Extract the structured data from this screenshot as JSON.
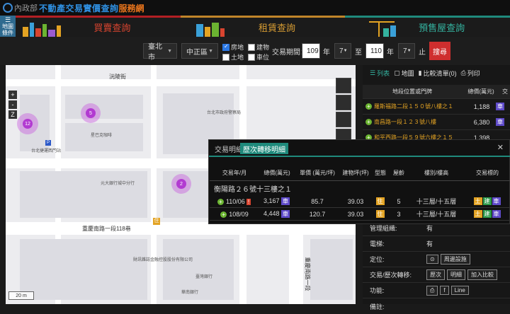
{
  "header": {
    "brand_prefix": "內政部",
    "brand_main": "不動產交易實價查詢",
    "brand_accent": "服務網"
  },
  "side_filter_label": "地圖條件",
  "tabs": [
    {
      "label": "買賣查詢"
    },
    {
      "label": "租賃查詢"
    },
    {
      "label": "預售屋查詢"
    }
  ],
  "filters": {
    "city": "臺北市",
    "district": "中正區",
    "types": [
      {
        "label": "房地",
        "checked": true
      },
      {
        "label": "建物",
        "checked": false
      },
      {
        "label": "土地",
        "checked": false
      },
      {
        "label": "車位",
        "checked": false
      }
    ],
    "period_label": "交易期間：",
    "year_from": "109",
    "month_from": "7",
    "year_to": "110",
    "month_to": "7",
    "unit_year": "年",
    "to_word": "至",
    "end_word": "止",
    "search_label": "搜尋"
  },
  "map": {
    "clusters": [
      {
        "count": "12"
      },
      {
        "count": "5"
      },
      {
        "count": "2"
      }
    ],
    "streets": {
      "a": "沅陵街",
      "b": "重慶南路一段118巷",
      "c": "重慶南路一段"
    },
    "labels": {
      "l1": "台北捷運西門站",
      "l2": "星巴克咖啡",
      "l3": "元大銀行城中分行",
      "l4": "財訊雜誌金融控股股份有限公司",
      "l5": "臺灣銀行",
      "l6": "台北市政府警察局",
      "l7": "華南銀行"
    },
    "scale_label": "20 m",
    "zoom_in": "+",
    "zoom_out": "-"
  },
  "right_pane": {
    "tab_list": "列表",
    "tab_map": "地圖",
    "tab_compare": "比較清單(0)",
    "tab_print": "列印",
    "columns": [
      "地段位置或門牌",
      "總價(萬元)",
      "交"
    ],
    "rows": [
      {
        "address": "羅斯福路二段１５０號八樓之１",
        "price": "1,188"
      },
      {
        "address": "南昌路一段１２３號八樓",
        "price": "6,380"
      },
      {
        "address": "和平西路一段５９號六樓之１５",
        "price": "1,398"
      }
    ],
    "details": [
      {
        "label": "管理組織:",
        "value": "有"
      },
      {
        "label": "電梯:",
        "value": "有"
      },
      {
        "label": "定位:",
        "value": "周邊設施"
      },
      {
        "label": "交易/歷次轉移:",
        "btn1": "歷次",
        "btn2": "明細",
        "btn3": "加入比較"
      },
      {
        "label": "功能:",
        "btn1": "print",
        "btn2": "f",
        "btn3": "Line"
      },
      {
        "label": "備註:",
        "value": ""
      }
    ]
  },
  "popup": {
    "tab1": "交易明細",
    "tab2": "歷次轉移明細",
    "close": "✕",
    "columns": [
      "交易年/月",
      "總價(萬元)",
      "單價 (萬元/坪)",
      "建物坪(坪)",
      "型態",
      "屋齡",
      "樓別/樓高",
      "交易標的"
    ],
    "group_title": "衡陽路２６號十三樓之１",
    "rows": [
      {
        "date": "110/06",
        "total": "3,167",
        "unit": "85.7",
        "area": "39.03",
        "age": "5",
        "floor": "十三層/十五層"
      },
      {
        "date": "108/09",
        "total": "4,448",
        "unit": "120.7",
        "area": "39.03",
        "age": "3",
        "floor": "十三層/十五層"
      }
    ]
  },
  "colors": {
    "buy": "#d8442f",
    "rent": "#d59b33",
    "presale": "#34b3a0",
    "search": "#cf2e2e",
    "plus": "#6bb431"
  }
}
